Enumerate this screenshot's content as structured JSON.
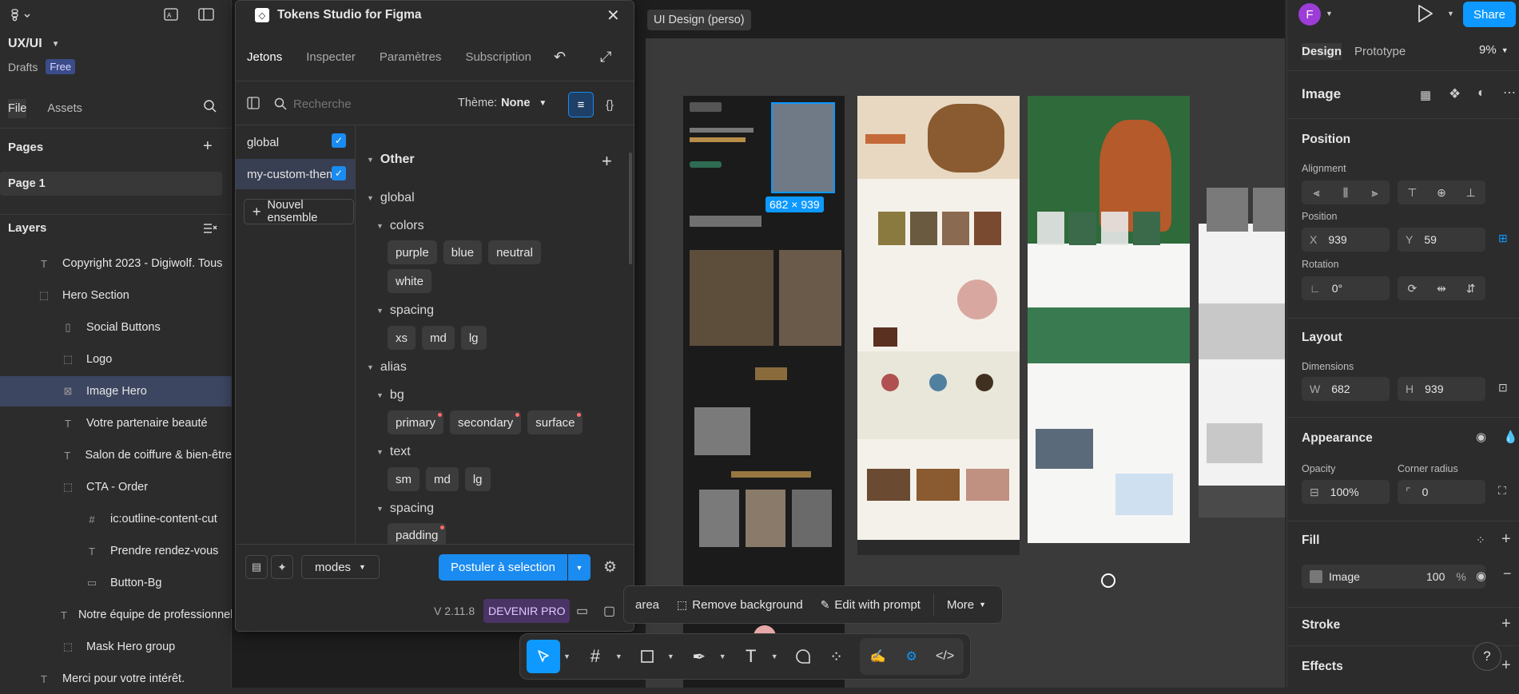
{
  "left_panel": {
    "file_name": "UX/UI",
    "drafts": "Drafts",
    "plan_badge": "Free",
    "tabs": [
      "File",
      "Assets"
    ],
    "pages_title": "Pages",
    "current_page": "Page 1",
    "layers_title": "Layers",
    "layers": [
      {
        "icon": "text",
        "name": "Copyright 2023 - Digiwolf. Tous"
      },
      {
        "icon": "frame",
        "name": "Hero Section"
      },
      {
        "icon": "component",
        "name": "Social Buttons"
      },
      {
        "icon": "frame",
        "name": "Logo"
      },
      {
        "icon": "image",
        "name": "Image Hero"
      },
      {
        "icon": "text",
        "name": "Votre partenaire beauté"
      },
      {
        "icon": "text",
        "name": "Salon de coiffure & bien-être"
      },
      {
        "icon": "frame",
        "name": "CTA - Order"
      },
      {
        "icon": "grid",
        "name": "ic:outline-content-cut"
      },
      {
        "icon": "text",
        "name": "Prendre rendez-vous"
      },
      {
        "icon": "rect",
        "name": "Button-Bg"
      },
      {
        "icon": "text",
        "name": "Notre équipe de professionnels"
      },
      {
        "icon": "frame",
        "name": "Mask Hero group"
      },
      {
        "icon": "text",
        "name": "Merci pour votre intérêt."
      }
    ]
  },
  "plugin": {
    "title": "Tokens Studio for Figma",
    "tabs": [
      "Jetons",
      "Inspecter",
      "Paramètres",
      "Subscription"
    ],
    "search_placeholder": "Recherche",
    "theme_label": "Thème:",
    "theme_value": "None",
    "sets": [
      {
        "name": "global",
        "checked": true
      },
      {
        "name": "my-custom-theme",
        "checked": true
      }
    ],
    "new_set": "Nouvel ensemble",
    "section": "Other",
    "groups": {
      "global": "global",
      "colors": "colors",
      "colors_tokens": [
        "purple",
        "blue",
        "neutral",
        "white"
      ],
      "spacing": "spacing",
      "spacing_tokens": [
        "xs",
        "md",
        "lg"
      ],
      "alias": "alias",
      "bg": "bg",
      "bg_tokens": [
        "primary",
        "secondary",
        "surface"
      ],
      "text": "text",
      "text_tokens": [
        "sm",
        "md",
        "lg"
      ],
      "spacing2": "spacing",
      "spacing2_tokens": [
        "padding"
      ]
    },
    "modes": "modes",
    "apply_button": "Postuler à selection",
    "version": "V 2.11.8",
    "pro_badge": "DEVENIR PRO"
  },
  "canvas": {
    "file_label": "UI Design (perso)",
    "selection_size": "682 × 939"
  },
  "ai_bar": {
    "partial": "area",
    "remove_bg": "Remove background",
    "edit_prompt": "Edit with prompt",
    "more": "More"
  },
  "right_panel": {
    "avatar": "F",
    "share": "Share",
    "tabs": [
      "Design",
      "Prototype"
    ],
    "zoom": "9%",
    "layer_type": "Image",
    "position_title": "Position",
    "alignment_label": "Alignment",
    "position_label": "Position",
    "x_label": "X",
    "x": "939",
    "y_label": "Y",
    "y": "59",
    "rotation_label": "Rotation",
    "rotation": "0°",
    "layout_title": "Layout",
    "dimensions_label": "Dimensions",
    "w_label": "W",
    "w": "682",
    "h_label": "H",
    "h": "939",
    "appearance_title": "Appearance",
    "opacity_label": "Opacity",
    "opacity": "100%",
    "radius_label": "Corner radius",
    "radius": "0",
    "fill_title": "Fill",
    "fill_type": "Image",
    "fill_opacity": "100",
    "fill_unit": "%",
    "stroke_title": "Stroke",
    "effects_title": "Effects",
    "help": "?"
  },
  "colors": {
    "accent": "#0d99ff",
    "selection": "#3d4660",
    "plugin_blue": "#1a8bf0",
    "pro_purple": "#4a3466",
    "canvas": "#1e1e1e"
  }
}
